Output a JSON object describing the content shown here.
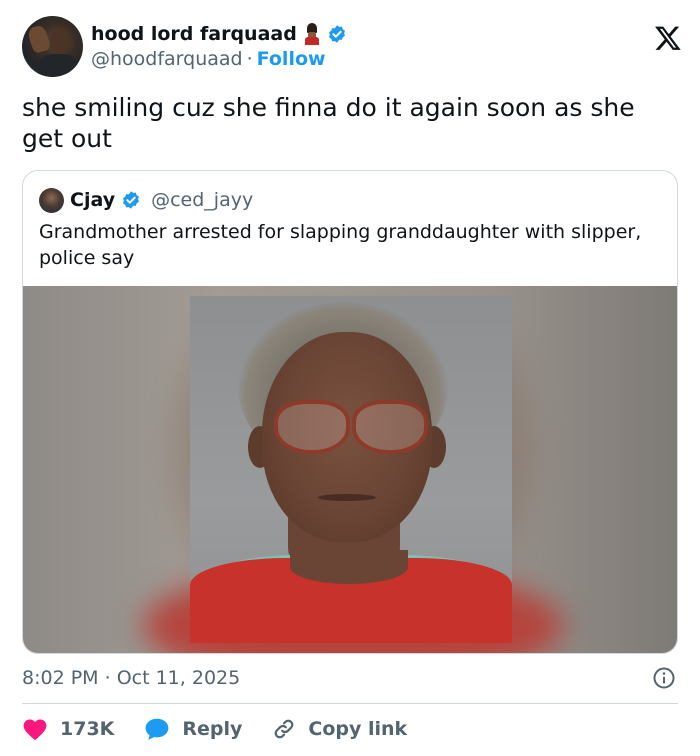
{
  "author": {
    "display_name": "hood lord farquaad",
    "handle": "@hoodfarquaad",
    "separator": "·",
    "follow_label": "Follow",
    "name_emoji": "guard-emoji",
    "verified_icon": "verified-badge-icon"
  },
  "platform_logo": "x-logo-icon",
  "tweet": {
    "text": "she smiling cuz she finna do it again soon as she get out"
  },
  "quoted_tweet": {
    "display_name": "Cjay",
    "handle": "@ced_jayy",
    "verified_icon": "verified-badge-icon",
    "text": "Grandmother arrested for slapping granddaughter with slipper, police say",
    "image": "mugshot-photo"
  },
  "timestamp": {
    "time": "8:02 PM",
    "separator": "·",
    "date": "Oct 11, 2025"
  },
  "actions": {
    "like_count": "173K",
    "reply_label": "Reply",
    "copy_link_label": "Copy link"
  },
  "colors": {
    "like_red": "#f91880",
    "reply_blue": "#1d9bf0",
    "verified_blue": "#1d9bf0",
    "secondary_text": "#536471",
    "primary_text": "#0f1419",
    "border": "#cfd9de"
  }
}
